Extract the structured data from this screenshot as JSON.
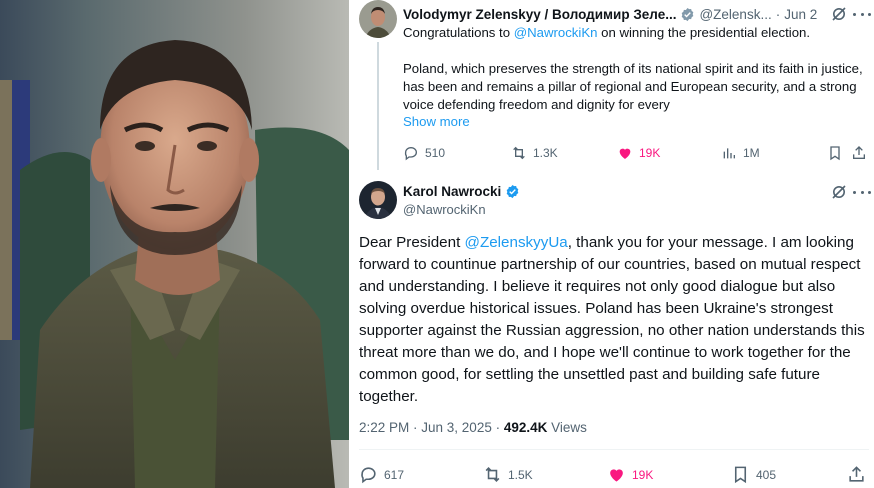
{
  "tweet1": {
    "author_name": "Volodymyr Zelenskyy / Володимир Зеле...",
    "author_handle": "@Zelensk...",
    "separator": "·",
    "date": "Jun 2",
    "text_prefix": "Congratulations to ",
    "mention": "@NawrockiKn",
    "text_suffix": " on winning the presidential election.",
    "paragraph2": "Poland, which preserves the strength of its national spirit and its faith in justice, has been and remains a pillar of regional and European security, and a strong voice defending freedom and dignity for every",
    "show_more": "Show more",
    "replies": "510",
    "reposts": "1.3K",
    "likes": "19K",
    "views": "1M"
  },
  "tweet2": {
    "author_name": "Karol Nawrocki",
    "author_handle": "@NawrockiKn",
    "greeting": "Dear President ",
    "mention": "@ZelenskyyUa",
    "body": ", thank you for your message. I am looking forward to countinue partnership of our countries, based on mutual respect and understanding. I believe it requires not only good dialogue but also solving overdue historical issues. Poland has been Ukraine's strongest supporter against the Russian aggression, no other nation understands this threat more than we do, and I hope we'll continue to work together for the common good, for settling the unsettled past and building safe future together.",
    "time": "2:22 PM · Jun 3, 2025 · ",
    "views_count": "492.4K",
    "views_label": " Views",
    "replies": "617",
    "reposts": "1.5K",
    "likes": "19K",
    "bookmarks": "405"
  },
  "colors": {
    "accent": "#1d9bf0",
    "like": "#f91880",
    "muted": "#536471",
    "verified_gold": "#e2b719"
  },
  "icons": [
    "verified-icon",
    "grok-icon",
    "more-icon",
    "reply-icon",
    "repost-icon",
    "like-icon",
    "views-icon",
    "bookmark-icon",
    "share-icon"
  ]
}
